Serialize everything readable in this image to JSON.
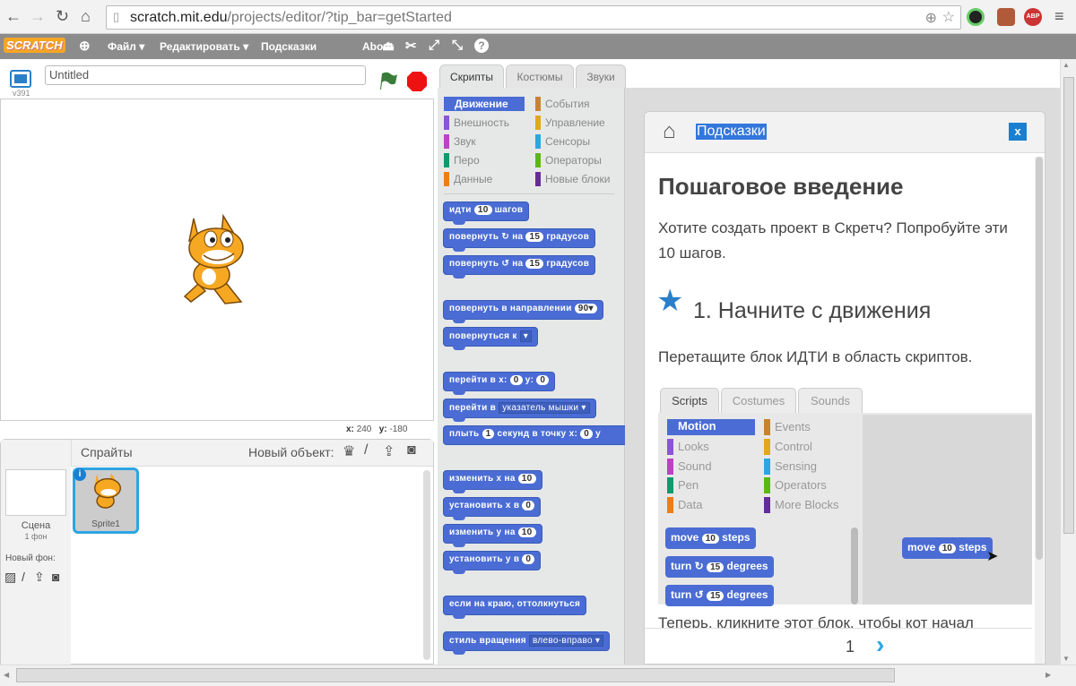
{
  "browser": {
    "url_host": "scratch.mit.edu",
    "url_path": "/projects/editor/?tip_bar=getStarted",
    "extensions": [
      "ABP"
    ]
  },
  "menubar": {
    "logo": "SCRATCH",
    "items": [
      "Файл ▾",
      "Редактировать ▾",
      "Подсказки",
      "About"
    ]
  },
  "stage": {
    "version": "v391",
    "project_title": "Untitled",
    "coords": {
      "x_label": "x:",
      "x": "240",
      "y_label": "y:",
      "y": "-180"
    }
  },
  "sprites": {
    "title": "Спрайты",
    "new_sprite_label": "Новый объект:",
    "scene_label": "Сцена",
    "scene_count": "1 фон",
    "new_backdrop_label": "Новый фон:",
    "items": [
      {
        "name": "Sprite1"
      }
    ]
  },
  "tabs": [
    "Скрипты",
    "Костюмы",
    "Звуки"
  ],
  "categories": [
    {
      "label": "Движение",
      "color": "#4a6cd4",
      "selected": true
    },
    {
      "label": "Внешность",
      "color": "#8a55d7"
    },
    {
      "label": "Звук",
      "color": "#bb42c3"
    },
    {
      "label": "Перо",
      "color": "#0e9a6c"
    },
    {
      "label": "Данные",
      "color": "#ee7d16"
    },
    {
      "label": "События",
      "color": "#c88330"
    },
    {
      "label": "Управление",
      "color": "#e1a91a"
    },
    {
      "label": "Сенсоры",
      "color": "#2ca5e2"
    },
    {
      "label": "Операторы",
      "color": "#5cb712"
    },
    {
      "label": "Новые блоки",
      "color": "#632d99"
    }
  ],
  "blocks": {
    "move": [
      "идти",
      "10",
      "шагов"
    ],
    "turn_right": [
      "повернуть",
      "на",
      "15",
      "градусов"
    ],
    "turn_left": [
      "повернуть",
      "на",
      "15",
      "градусов"
    ],
    "point_dir": [
      "повернуть в направлении",
      "90▾"
    ],
    "point_towards": [
      "повернуться к"
    ],
    "goto_xy": [
      "перейти в x:",
      "0",
      "y:",
      "0"
    ],
    "goto": [
      "перейти в",
      "указатель мышки"
    ],
    "glide": [
      "плыть",
      "1",
      "секунд в точку x:",
      "0",
      "y"
    ],
    "change_x": [
      "изменить x на",
      "10"
    ],
    "set_x": [
      "установить x в",
      "0"
    ],
    "change_y": [
      "изменить y на",
      "10"
    ],
    "set_y": [
      "установить y в",
      "0"
    ],
    "bounce": "если на краю, оттолкнуться",
    "rotation_style": [
      "стиль вращения",
      "влево-вправо"
    ]
  },
  "tips": {
    "header": "Подсказки",
    "close": "x",
    "title": "Пошаговое введение",
    "intro": "Хотите создать проект в Скретч? Попробуйте эти 10 шагов.",
    "step_title": "1. Начните с движения",
    "step_text": "Перетащите блок ИДТИ в область скриптов.",
    "next_text": "Теперь, кликните этот блок, чтобы кот начал",
    "page": "1",
    "example": {
      "tabs": [
        "Scripts",
        "Costumes",
        "Sounds"
      ],
      "categories": [
        {
          "label": "Motion",
          "color": "#4a6cd4"
        },
        {
          "label": "Looks",
          "color": "#8a55d7"
        },
        {
          "label": "Sound",
          "color": "#bb42c3"
        },
        {
          "label": "Pen",
          "color": "#0e9a6c"
        },
        {
          "label": "Data",
          "color": "#ee7d16"
        },
        {
          "label": "Events",
          "color": "#c88330"
        },
        {
          "label": "Control",
          "color": "#e1a91a"
        },
        {
          "label": "Sensing",
          "color": "#2ca5e2"
        },
        {
          "label": "Operators",
          "color": "#5cb712"
        },
        {
          "label": "More Blocks",
          "color": "#632d99"
        }
      ],
      "move": [
        "move",
        "10",
        "steps"
      ],
      "turn_right": [
        "turn",
        "15",
        "degrees"
      ],
      "turn_left": [
        "turn",
        "15",
        "degrees"
      ]
    }
  }
}
